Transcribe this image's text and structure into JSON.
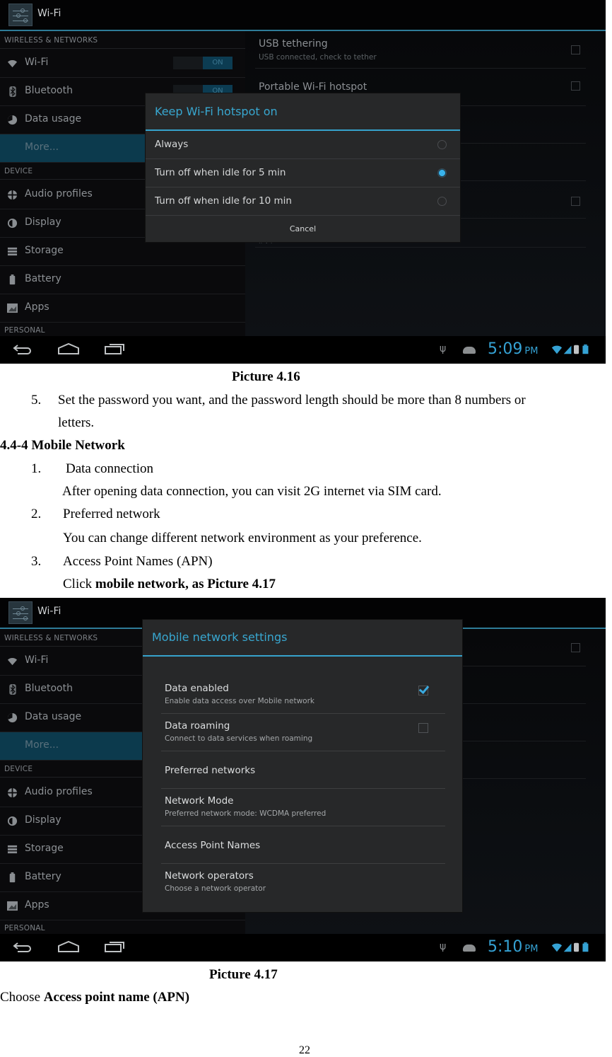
{
  "screenshot1": {
    "app_title": "Wi-Fi",
    "sidebar": {
      "section_wireless": "WIRELESS & NETWORKS",
      "section_device": "DEVICE",
      "section_personal": "PERSONAL",
      "items": [
        {
          "label": "Wi-Fi",
          "icon": "wifi-icon",
          "toggle": "ON"
        },
        {
          "label": "Bluetooth",
          "icon": "bluetooth-icon",
          "toggle": "ON"
        },
        {
          "label": "Data usage",
          "icon": "data-usage-icon"
        },
        {
          "label": "More...",
          "selected": true
        },
        {
          "label": "Audio profiles",
          "icon": "audio-profiles-icon"
        },
        {
          "label": "Display",
          "icon": "display-icon"
        },
        {
          "label": "Storage",
          "icon": "storage-icon"
        },
        {
          "label": "Battery",
          "icon": "battery-icon"
        },
        {
          "label": "Apps",
          "icon": "apps-icon"
        }
      ]
    },
    "right_pane": {
      "usb_tethering_title": "USB tethering",
      "usb_tethering_summary": "USB connected, check to tether",
      "hotspot_title": "Portable Wi-Fi hotspot",
      "ipv4_label": "IPV4"
    },
    "dialog": {
      "title": "Keep Wi-Fi hotspot on",
      "options": [
        {
          "label": "Always",
          "selected": false
        },
        {
          "label": "Turn off when idle for 5 min",
          "selected": true
        },
        {
          "label": "Turn off when idle for 10 min",
          "selected": false
        }
      ],
      "cancel_label": "Cancel"
    },
    "statusbar": {
      "time": "5:09",
      "ampm": "PM"
    }
  },
  "caption1": "Picture 4.16",
  "step5_number": "5.",
  "step5_line1": "Set the password you want, and the password length should be more than 8 numbers or",
  "step5_line2": "letters.",
  "section_heading": "4.4-4 Mobile Network",
  "steps": [
    {
      "number": "1.",
      "title": "Data connection",
      "body": "After opening data connection, you can visit 2G internet via SIM card."
    },
    {
      "number": "2.",
      "title": "Preferred network",
      "body": "You can change different network environment as your preference."
    },
    {
      "number": "3.",
      "title": "Access Point Names (APN)",
      "body_prefix": "Click ",
      "body_bold": "mobile network, as Picture 4.17"
    }
  ],
  "screenshot2": {
    "app_title": "Wi-Fi",
    "dialog": {
      "title": "Mobile network settings",
      "items": [
        {
          "title": "Data enabled",
          "summary": "Enable data access over Mobile network",
          "checked": true
        },
        {
          "title": "Data roaming",
          "summary": "Connect to data services when roaming",
          "checked": false
        },
        {
          "title": "Preferred networks"
        },
        {
          "title": "Network Mode",
          "summary": "Preferred network mode: WCDMA preferred"
        },
        {
          "title": "Access Point Names"
        },
        {
          "title": "Network operators",
          "summary": "Choose a network operator"
        }
      ]
    },
    "statusbar": {
      "time": "5:10",
      "ampm": "PM"
    }
  },
  "caption2": "Picture 4.17",
  "final_prefix": "Choose ",
  "final_bold": "Access point name (APN)",
  "page_number": "22",
  "colors": {
    "accent": "#35a2d4",
    "selected_row": "#0c3a4d",
    "dialog_bg": "#272829"
  }
}
